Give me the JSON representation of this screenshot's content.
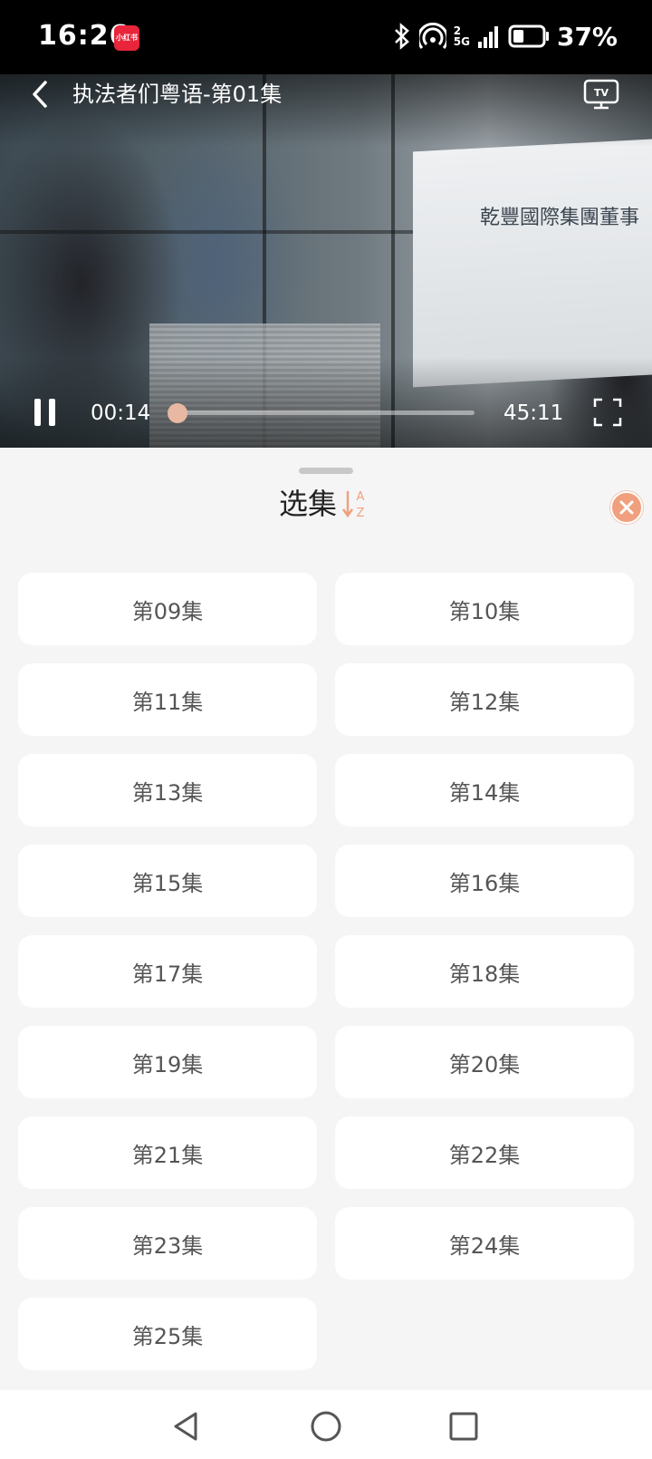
{
  "status_bar": {
    "time": "16:26",
    "app_badge": "小红书",
    "network_label": "5G",
    "signal_count": "2",
    "battery": "37%",
    "battery_level": 0.37
  },
  "player": {
    "title": "执法者们粤语-第01集",
    "current_time": "00:14",
    "total_time": "45:11",
    "progress": 0.005,
    "scene_board_text": "乾豐國際集團董事",
    "tv_label": "TV",
    "accent_color": "#e9b8a2"
  },
  "sheet": {
    "title": "选集",
    "sort_label_top": "A",
    "sort_label_bottom": "Z",
    "sort_color": "#f0a07e",
    "episodes": [
      "第09集",
      "第10集",
      "第11集",
      "第12集",
      "第13集",
      "第14集",
      "第15集",
      "第16集",
      "第17集",
      "第18集",
      "第19集",
      "第20集",
      "第21集",
      "第22集",
      "第23集",
      "第24集",
      "第25集"
    ]
  },
  "nav": {
    "icons": [
      "back-triangle-icon",
      "home-circle-icon",
      "recents-square-icon"
    ]
  }
}
